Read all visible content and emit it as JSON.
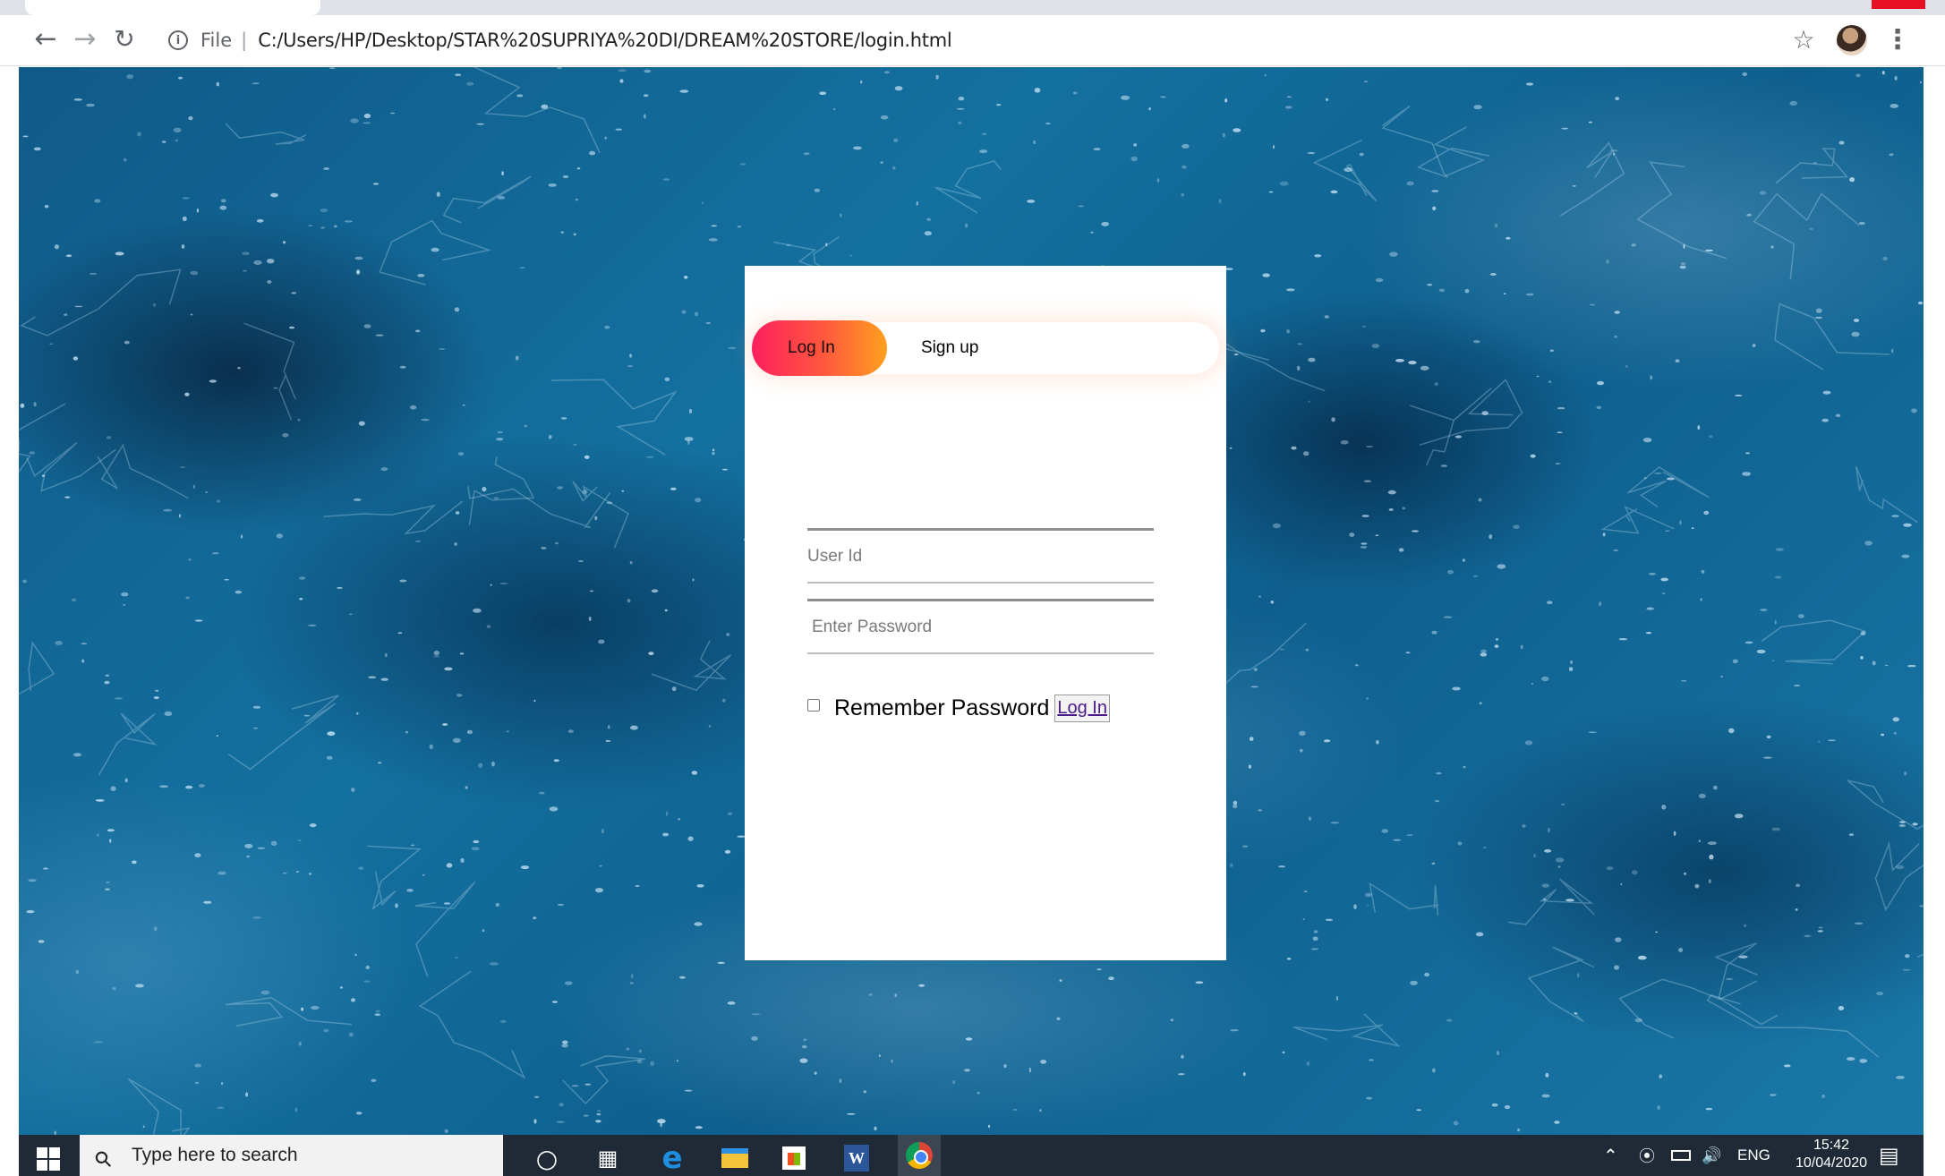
{
  "browser": {
    "address_scheme": "File",
    "address_separator": "|",
    "address_url": "C:/Users/HP/Desktop/STAR%20SUPRIYA%20DI/DREAM%20STORE/login.html",
    "back_icon": "arrow-left",
    "forward_icon": "arrow-right",
    "reload_icon": "reload",
    "info_icon": "info",
    "bookmark_icon": "star-outline",
    "menu_icon": "vertical-ellipsis"
  },
  "login_card": {
    "tabs": {
      "login_label": "Log In",
      "signup_label": "Sign up",
      "active": "login"
    },
    "user_field": {
      "placeholder": "User Id",
      "value": ""
    },
    "password_field": {
      "placeholder": "Enter Password",
      "value": ""
    },
    "remember": {
      "label": "Remember Password",
      "checked": false
    },
    "submit_label": "Log In",
    "colors": {
      "pill_start": "#ff1f5e",
      "pill_end": "#ffa01e"
    }
  },
  "taskbar": {
    "search_placeholder": "Type here to search",
    "language": "ENG",
    "time": "15:42",
    "date": "10/04/2020",
    "icons": [
      "windows-start",
      "search",
      "cortana",
      "task-view",
      "edge",
      "file-explorer",
      "store",
      "word",
      "chrome"
    ],
    "tray_icons": [
      "show-hidden-chevron",
      "wifi",
      "battery",
      "volume",
      "notifications"
    ]
  }
}
